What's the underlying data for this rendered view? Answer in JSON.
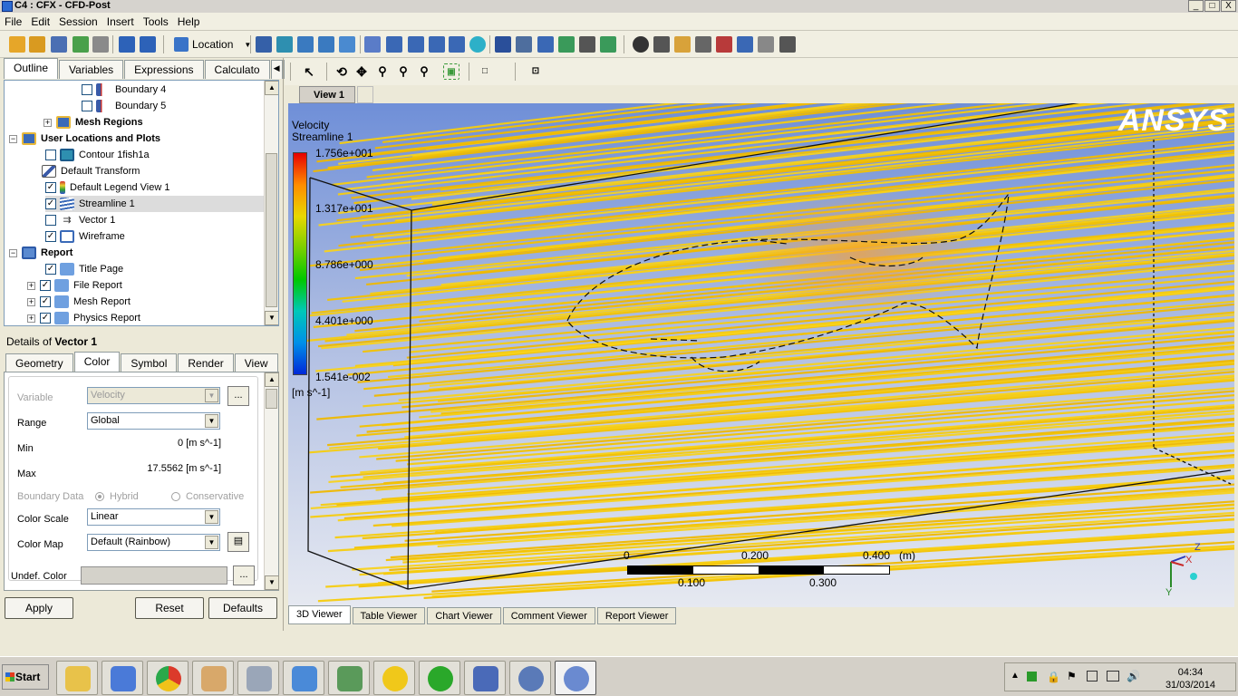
{
  "window": {
    "title": "C4 : CFX - CFD-Post",
    "min": "_",
    "max": "□",
    "close": "X"
  },
  "menu": [
    "File",
    "Edit",
    "Session",
    "Insert",
    "Tools",
    "Help"
  ],
  "toolbar": {
    "location_label": "Location"
  },
  "left_tabs": [
    "Outline",
    "Variables",
    "Expressions",
    "Calculato"
  ],
  "tree": [
    {
      "label": "Boundary 4",
      "checked": false,
      "bold": false
    },
    {
      "label": "Boundary 5",
      "checked": false,
      "bold": false
    },
    {
      "label": "Mesh Regions",
      "checked": null,
      "bold": true
    },
    {
      "label": "User Locations and Plots",
      "checked": null,
      "bold": true
    },
    {
      "label": "Contour 1fish1a",
      "checked": false,
      "bold": false
    },
    {
      "label": "Default Transform",
      "checked": null,
      "bold": false
    },
    {
      "label": "Default Legend View 1",
      "checked": true,
      "bold": false
    },
    {
      "label": "Streamline 1",
      "checked": true,
      "bold": false
    },
    {
      "label": "Vector 1",
      "checked": false,
      "bold": false
    },
    {
      "label": "Wireframe",
      "checked": true,
      "bold": false
    },
    {
      "label": "Report",
      "checked": null,
      "bold": true
    },
    {
      "label": "Title Page",
      "checked": true,
      "bold": false
    },
    {
      "label": "File Report",
      "checked": true,
      "bold": false
    },
    {
      "label": "Mesh Report",
      "checked": true,
      "bold": false
    },
    {
      "label": "Physics Report",
      "checked": true,
      "bold": false
    }
  ],
  "details": {
    "prefix": "Details of",
    "object": "Vector 1",
    "tabs": [
      "Geometry",
      "Color",
      "Symbol",
      "Render",
      "View"
    ],
    "variable_label": "Variable",
    "variable_value": "Velocity",
    "range_label": "Range",
    "range_value": "Global",
    "min_label": "Min",
    "min_value": "0 [m s^-1]",
    "max_label": "Max",
    "max_value": "17.5562 [m s^-1]",
    "boundary_label": "Boundary Data",
    "hybrid_label": "Hybrid",
    "conservative_label": "Conservative",
    "color_scale_label": "Color Scale",
    "color_scale_value": "Linear",
    "color_map_label": "Color Map",
    "color_map_value": "Default (Rainbow)",
    "undef_label": "Undef. Color",
    "ellipsis": "...",
    "apply": "Apply",
    "reset": "Reset",
    "defaults": "Defaults"
  },
  "viewer": {
    "view_tab": "View 1",
    "legend_title": "Velocity",
    "legend_subtitle": "Streamline 1",
    "legend_ticks": [
      "1.756e+001",
      "1.317e+001",
      "8.786e+000",
      "4.401e+000",
      "1.541e-002"
    ],
    "legend_unit": "[m s^-1]",
    "logo": "ANSYS",
    "scale_top": [
      "0",
      "0.200",
      "0.400",
      "(m)"
    ],
    "scale_bottom": [
      "0.100",
      "0.300"
    ],
    "axis_labels": [
      "Z",
      "X",
      "Y"
    ],
    "bottom_tabs": [
      "3D Viewer",
      "Table Viewer",
      "Chart Viewer",
      "Comment Viewer",
      "Report Viewer"
    ]
  },
  "taskbar": {
    "start": "Start",
    "time": "04:34",
    "date": "31/03/2014"
  }
}
